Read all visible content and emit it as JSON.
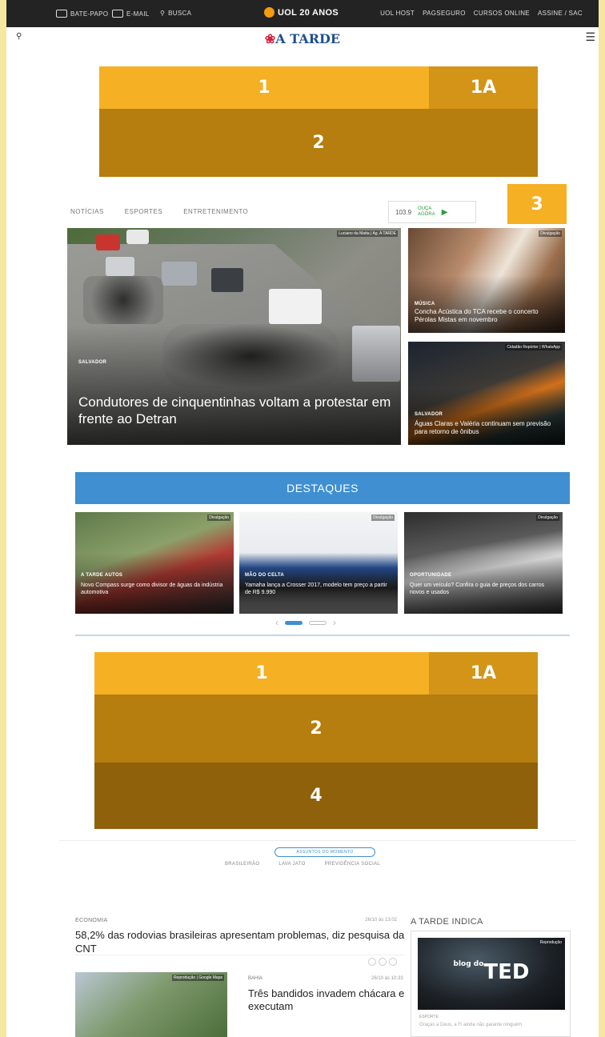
{
  "topbar": {
    "left": [
      {
        "label": "BATE-PAPO",
        "icon": "chat-icon"
      },
      {
        "label": "E-MAIL",
        "icon": "mail-icon"
      },
      {
        "label": "BUSCA",
        "icon": "search-icon"
      }
    ],
    "center": "UOL 20 ANOS",
    "right": [
      "UOL HOST",
      "PAGSEGURO",
      "CURSOS ONLINE",
      "ASSINE / SAC"
    ]
  },
  "header": {
    "logo": "A TARDE",
    "search_icon": "search-icon",
    "menu_icon": "hamburger-icon"
  },
  "ads": {
    "top": {
      "b1": "1",
      "b1a": "1A",
      "b2": "2"
    },
    "side": "3",
    "mid": {
      "b1": "1",
      "b1a": "1A",
      "b2": "2",
      "b4": "4"
    },
    "colors": {
      "light": "#f5b023",
      "medium": "#d39418",
      "dark": "#b67d0f",
      "darker": "#8f610a"
    }
  },
  "nav": [
    "NOTÍCIAS",
    "ESPORTES",
    "ENTRETENIMENTO"
  ],
  "radio": {
    "freq": "103.9",
    "label1": "OUÇA",
    "label2": "AGORA"
  },
  "hero": {
    "credit": "Luciano da Matta | Ag. A TARDE",
    "category": "SALVADOR",
    "title": "Condutores de cinquentinhas voltam a protestar em frente ao Detran"
  },
  "side_stories": [
    {
      "credit": "Divulgação",
      "category": "MÚSICA",
      "title": "Concha Acústica do TCA recebe o concerto Pérolas Mistas em novembro"
    },
    {
      "credit": "Cidadão Repórter | WhatsApp",
      "category": "SALVADOR",
      "title": "Águas Claras e Valéria continuam sem previsão para retorno de ônibus"
    }
  ],
  "destaques": {
    "title": "DESTAQUES",
    "items": [
      {
        "credit": "Divulgação",
        "category": "A TARDE AUTOS",
        "title": "Novo Compass surge como divisor de águas da indústria automotiva"
      },
      {
        "credit": "Divulgação",
        "category": "MÃO DO CELTA",
        "title": "Yamaha lança a Crosser 2017, modelo tem preço a partir de R$ 9.990"
      },
      {
        "credit": "Divulgação",
        "category": "OPORTUNIDADE",
        "title": "Quer um veículo? Confira o guia de preços dos carros novos e usados"
      }
    ],
    "prev": "‹",
    "next": "›"
  },
  "assuntos": {
    "label": "ASSUNTOS DO MOMENTO",
    "tags": [
      "BRASILEIRÃO",
      "LAVA JATO",
      "PREVIDÊNCIA SOCIAL"
    ]
  },
  "news": [
    {
      "category": "ECONOMIA",
      "date": "26/10 às 13:02",
      "title": "58,2% das rodovias brasileiras apresentam problemas, diz pesquisa da CNT"
    },
    {
      "category": "BAHIA",
      "date": "26/10 às 10:33",
      "title": "Três bandidos invadem chácara e executam",
      "credit": "Reprodução | Google Maps"
    }
  ],
  "indica": {
    "title": "A TARDE INDICA",
    "credit": "Reprodução",
    "logo_small": "blog do",
    "logo": "TED",
    "category": "ESPORTE",
    "desc": "Graças a Deus, a Fi ainda não garante ninguém"
  }
}
